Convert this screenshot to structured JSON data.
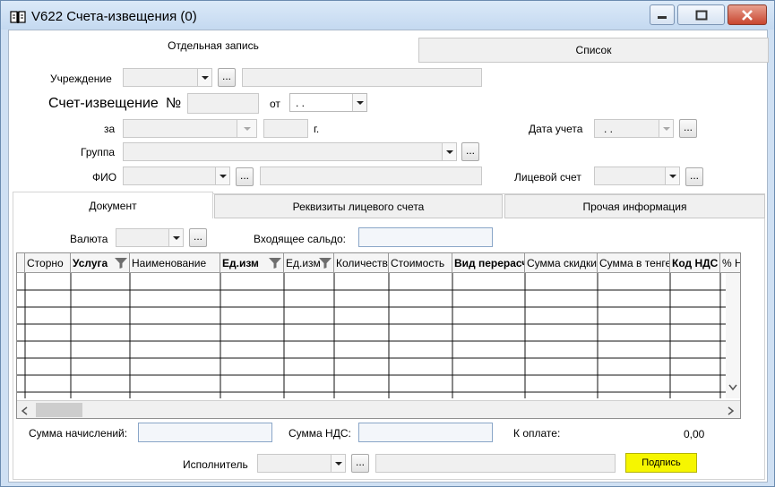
{
  "window": {
    "title": "V622 Счета-извещения (0)"
  },
  "top_tabs": [
    {
      "label": "Отдельная запись",
      "active": true
    },
    {
      "label": "Список",
      "active": false
    }
  ],
  "form": {
    "institution_label": "Учреждение",
    "invoice_label": "Счет-извещение",
    "number_label": "№",
    "from_label": "от",
    "date_value": " .  .",
    "for_label": "за",
    "year_suffix": "г.",
    "accounting_date_label": "Дата учета",
    "accounting_date_value": " .  .",
    "group_label": "Группа",
    "fio_label": "ФИО",
    "personal_account_label": "Лицевой счет",
    "ellipsis": "..."
  },
  "sub_tabs": [
    {
      "label": "Документ",
      "active": true
    },
    {
      "label": "Реквизиты лицевого счета",
      "active": false
    },
    {
      "label": "Прочая информация",
      "active": false
    }
  ],
  "document": {
    "currency_label": "Валюта",
    "incoming_balance_label": "Входящее сальдо:"
  },
  "grid": {
    "columns": [
      {
        "label": "Сторно",
        "bold": false,
        "filter": false
      },
      {
        "label": "Услуга",
        "bold": true,
        "filter": true
      },
      {
        "label": "Наименование",
        "bold": false,
        "filter": false
      },
      {
        "label": "Ед.изм",
        "bold": true,
        "filter": true
      },
      {
        "label": "Ед.изм",
        "bold": false,
        "filter": true
      },
      {
        "label": "Количество",
        "bold": false,
        "filter": false
      },
      {
        "label": "Стоимость",
        "bold": false,
        "filter": false
      },
      {
        "label": "Вид перерасчета",
        "bold": true,
        "filter": false
      },
      {
        "label": "Сумма скидки",
        "bold": false,
        "filter": false
      },
      {
        "label": "Сумма в тенге",
        "bold": false,
        "filter": false
      },
      {
        "label": "Код НДС",
        "bold": true,
        "filter": false
      },
      {
        "label": "% НДС",
        "bold": false,
        "filter": false
      }
    ]
  },
  "totals": {
    "accruals_label": "Сумма начислений:",
    "vat_label": "Сумма НДС:",
    "to_pay_label": "К оплате:",
    "to_pay_value": "0,00"
  },
  "footer": {
    "executor_label": "Исполнитель",
    "sign_button": "Подпись",
    "sign_color": "#f6f600"
  },
  "icons": {
    "app": "book-icon",
    "minimize": "minimize-icon",
    "maximize": "maximize-icon",
    "close": "close-icon",
    "filter": "filter-icon",
    "scroll_down": "chevron-down-icon",
    "scroll_left": "chevron-left-icon",
    "scroll_right": "chevron-right-icon"
  }
}
